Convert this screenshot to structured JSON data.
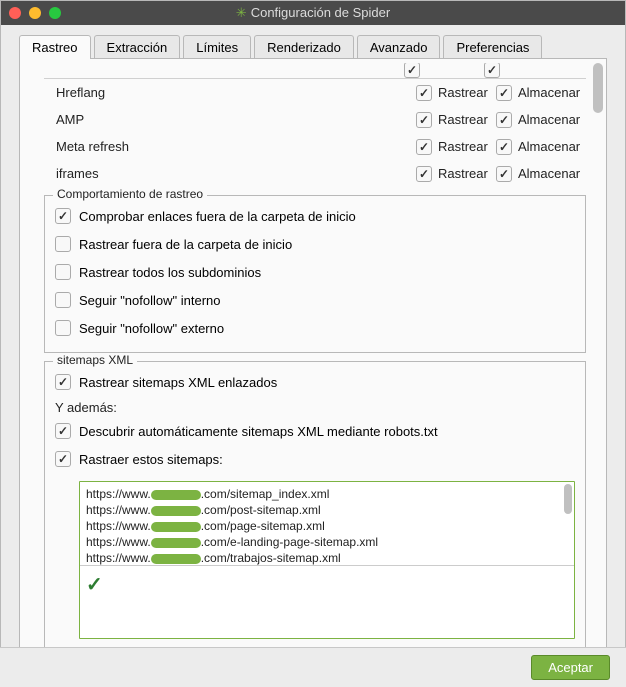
{
  "window": {
    "title": "Configuración de Spider"
  },
  "tabs": [
    {
      "label": "Rastreo",
      "active": true
    },
    {
      "label": "Extracción",
      "active": false
    },
    {
      "label": "Límites",
      "active": false
    },
    {
      "label": "Renderizado",
      "active": false
    },
    {
      "label": "Avanzado",
      "active": false
    },
    {
      "label": "Preferencias",
      "active": false
    }
  ],
  "linkRows": [
    {
      "label": "Hreflang",
      "rastrear": true,
      "almacenar": true
    },
    {
      "label": "AMP",
      "rastrear": true,
      "almacenar": true
    },
    {
      "label": "Meta refresh",
      "rastrear": true,
      "almacenar": true
    },
    {
      "label": "iframes",
      "rastrear": true,
      "almacenar": true
    }
  ],
  "linkCols": {
    "rastrear": "Rastrear",
    "almacenar": "Almacenar"
  },
  "behavior": {
    "legend": "Comportamiento de rastreo",
    "items": [
      {
        "label": "Comprobar enlaces fuera de la carpeta de inicio",
        "checked": true
      },
      {
        "label": "Rastrear fuera de la carpeta de inicio",
        "checked": false
      },
      {
        "label": "Rastrear todos los subdominios",
        "checked": false
      },
      {
        "label": "Seguir \"nofollow\" interno",
        "checked": false
      },
      {
        "label": "Seguir \"nofollow\" externo",
        "checked": false
      }
    ]
  },
  "sitemaps": {
    "legend": "sitemaps XML",
    "crawlLinked": {
      "label": "Rastrear sitemaps XML enlazados",
      "checked": true
    },
    "also": "Y además:",
    "discover": {
      "label": "Descubrir automáticamente sitemaps XML mediante robots.txt",
      "checked": true
    },
    "crawlThese": {
      "label": "Rastraer estos sitemaps:",
      "checked": true
    },
    "urls": [
      {
        "pre": "https://www.",
        "redactW": 50,
        "post": ".com/sitemap_index.xml"
      },
      {
        "pre": "https://www.",
        "redactW": 50,
        "post": ".com/post-sitemap.xml"
      },
      {
        "pre": "https://www.",
        "redactW": 50,
        "post": ".com/page-sitemap.xml"
      },
      {
        "pre": "https://www.",
        "redactW": 50,
        "post": ".com/e-landing-page-sitemap.xml"
      },
      {
        "pre": "https://www.",
        "redactW": 50,
        "post": ".com/trabajos-sitemap.xml"
      }
    ]
  },
  "footer": {
    "accept": "Aceptar"
  }
}
